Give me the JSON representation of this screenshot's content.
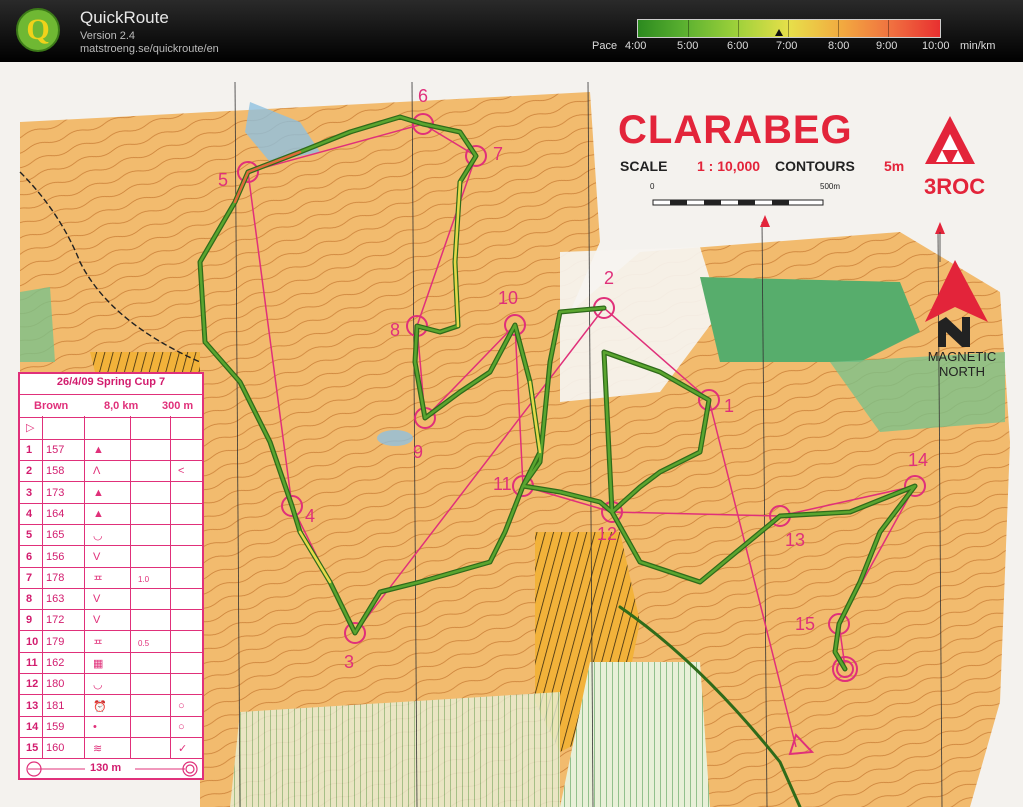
{
  "app": {
    "name": "QuickRoute",
    "version": "Version 2.4",
    "url": "matstroeng.se/quickroute/en"
  },
  "pace_scale": {
    "label": "Pace",
    "ticks": [
      "4:00",
      "5:00",
      "6:00",
      "7:00",
      "8:00",
      "9:00",
      "10:00"
    ],
    "unit": "min/km",
    "colors": [
      "#2c8a1f",
      "#9bd03a",
      "#e7e04a",
      "#f2a840",
      "#e83030"
    ]
  },
  "map": {
    "title": "CLARABEG",
    "scale_label": "SCALE",
    "scale_value": "1 : 10,000",
    "contours_label": "CONTOURS",
    "contours_value": "5m",
    "scale_bar_start": "0",
    "scale_bar_end": "500m",
    "club": "3ROC",
    "magnetic_north": "MAGNETIC NORTH",
    "control_labels": [
      "1",
      "2",
      "3",
      "4",
      "5",
      "6",
      "7",
      "8",
      "9",
      "10",
      "11",
      "12",
      "13",
      "14",
      "15"
    ]
  },
  "control_card": {
    "title": "26/4/09 Spring Cup 7",
    "course": "Brown",
    "length": "8,0 km",
    "climb": "300 m",
    "start_symbol": "▷",
    "controls": [
      {
        "num": "1",
        "code": "157",
        "symbol": "▲",
        "dim": "",
        "extra": ""
      },
      {
        "num": "2",
        "code": "158",
        "symbol": "Λ",
        "dim": "",
        "extra": "<"
      },
      {
        "num": "3",
        "code": "173",
        "symbol": "▲",
        "dim": "",
        "extra": ""
      },
      {
        "num": "4",
        "code": "164",
        "symbol": "▲",
        "dim": "",
        "extra": ""
      },
      {
        "num": "5",
        "code": "165",
        "symbol": "◡",
        "dim": "",
        "extra": ""
      },
      {
        "num": "6",
        "code": "156",
        "symbol": "V",
        "dim": "",
        "extra": ""
      },
      {
        "num": "7",
        "code": "178",
        "symbol": "ᄑ",
        "dim": "1.0",
        "extra": ""
      },
      {
        "num": "8",
        "code": "163",
        "symbol": "V",
        "dim": "",
        "extra": ""
      },
      {
        "num": "9",
        "code": "172",
        "symbol": "V",
        "dim": "",
        "extra": ""
      },
      {
        "num": "10",
        "code": "179",
        "symbol": "ᄑ",
        "dim": "0.5",
        "extra": ""
      },
      {
        "num": "11",
        "code": "162",
        "symbol": "▦",
        "dim": "",
        "extra": ""
      },
      {
        "num": "12",
        "code": "180",
        "symbol": "◡",
        "dim": "",
        "extra": ""
      },
      {
        "num": "13",
        "code": "181",
        "symbol": "⏰",
        "dim": "",
        "extra": "○"
      },
      {
        "num": "14",
        "code": "159",
        "symbol": "•",
        "dim": "",
        "extra": "○"
      },
      {
        "num": "15",
        "code": "160",
        "symbol": "≋",
        "dim": "",
        "extra": "✓"
      }
    ],
    "finish_distance": "130 m"
  }
}
